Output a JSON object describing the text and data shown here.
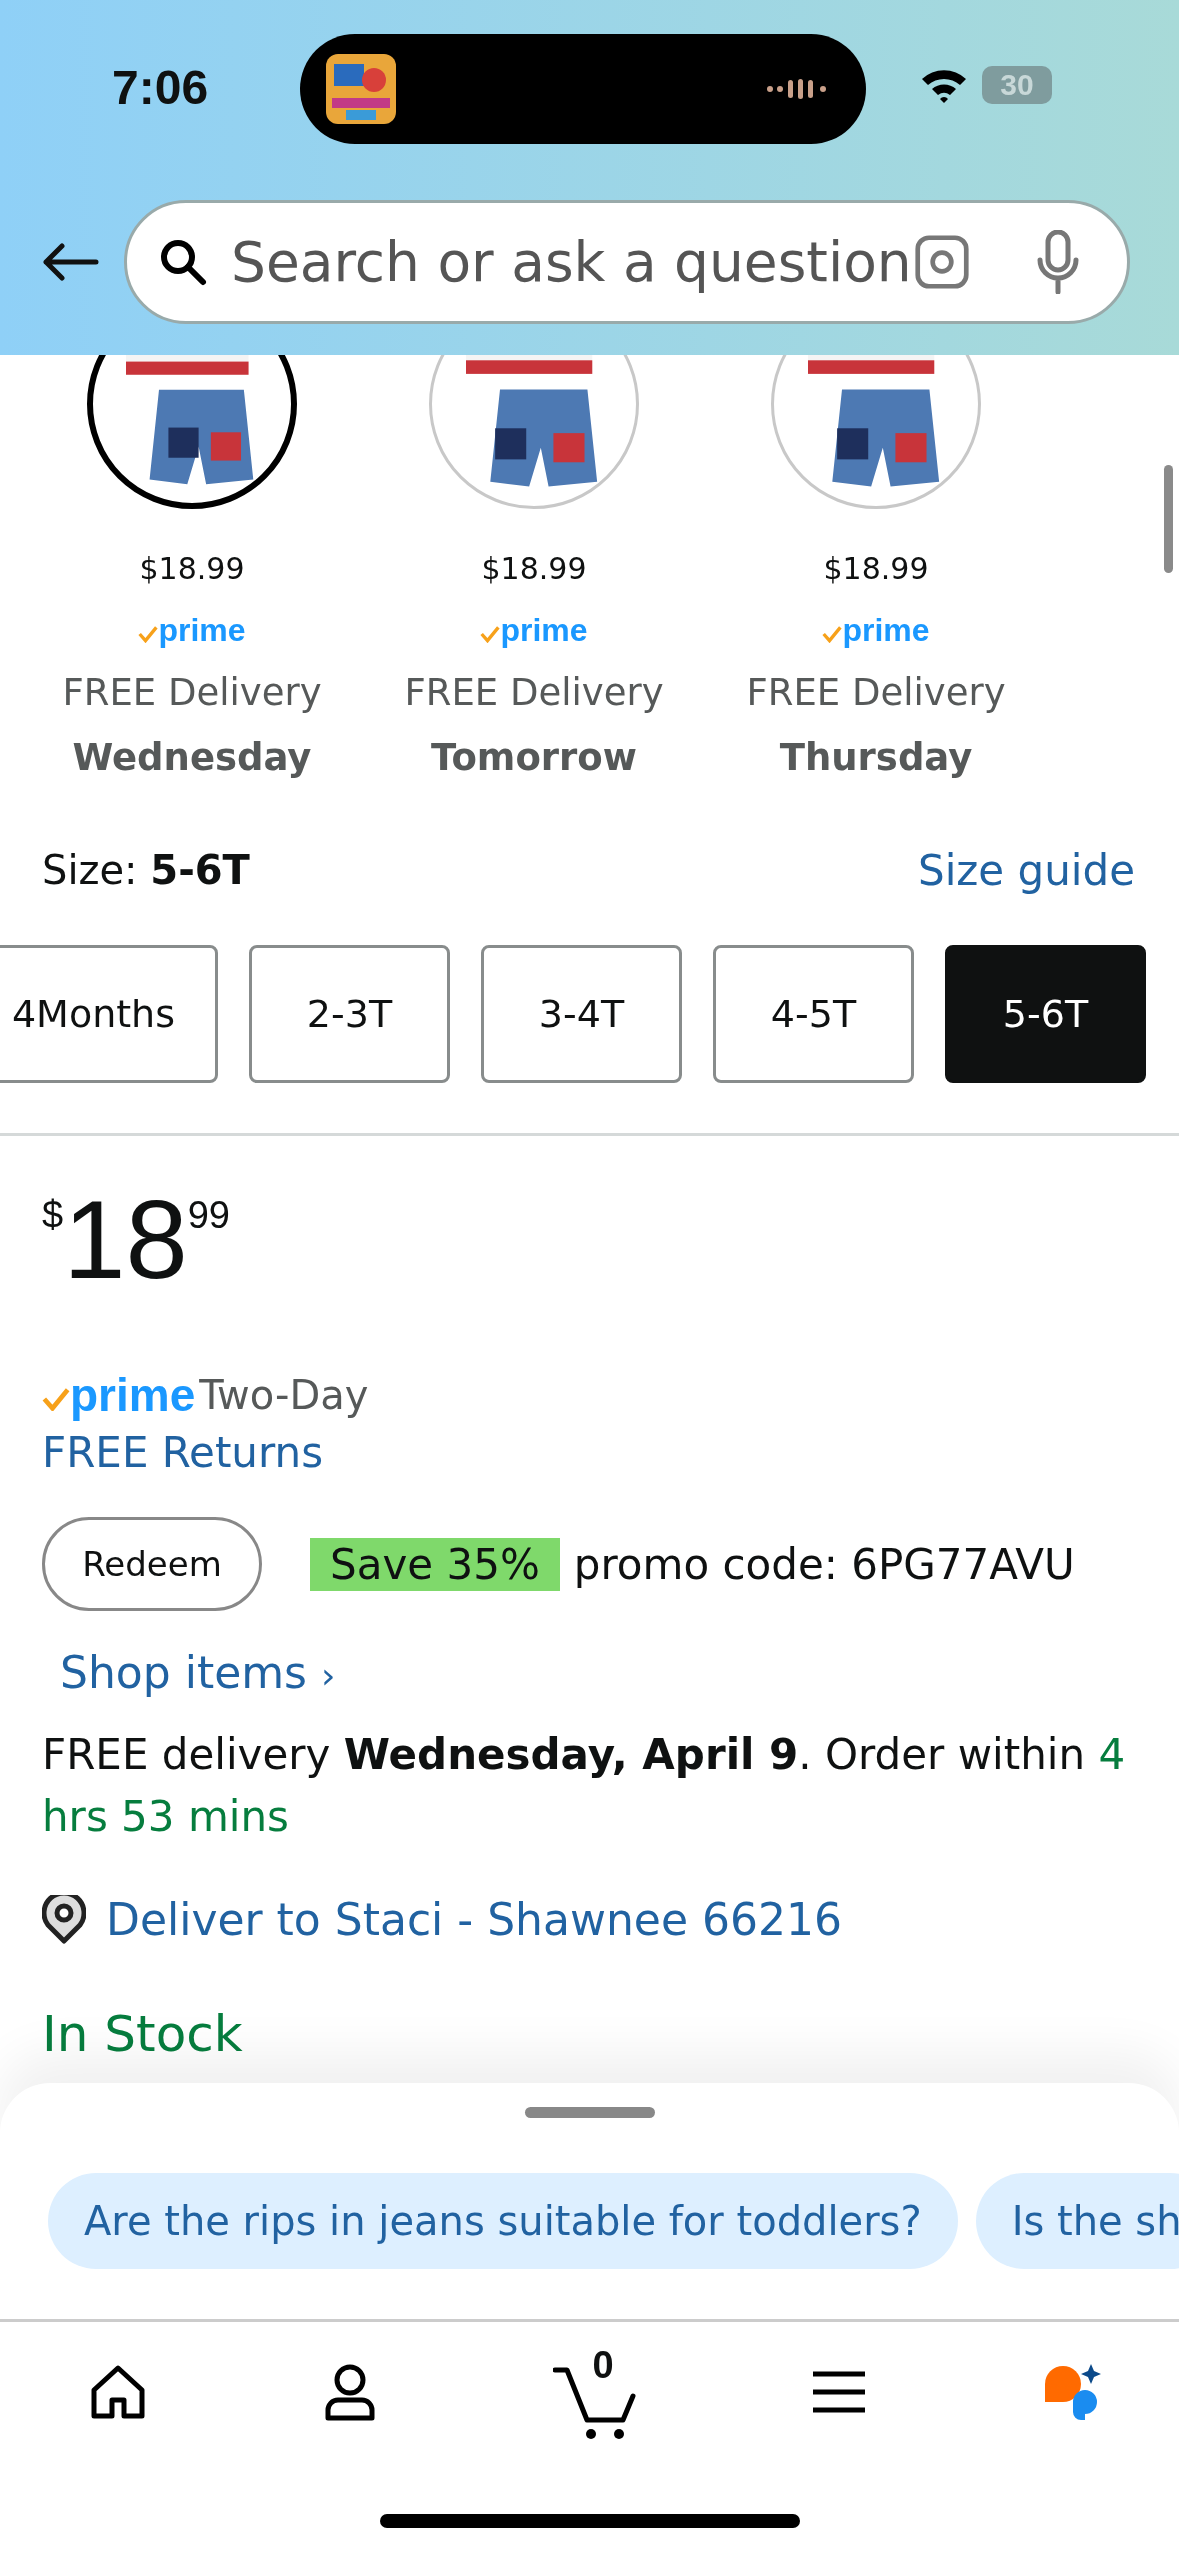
{
  "status_bar": {
    "time": "7:06",
    "battery": "30"
  },
  "search": {
    "placeholder": "Search or ask a question"
  },
  "variants": [
    {
      "price": "$18.99",
      "badge": "prime",
      "delivery": "FREE Delivery",
      "day": "Wednesday",
      "selected": true
    },
    {
      "price": "$18.99",
      "badge": "prime",
      "delivery": "FREE Delivery",
      "day": "Tomorrow",
      "selected": false
    },
    {
      "price": "$18.99",
      "badge": "prime",
      "delivery": "FREE Delivery",
      "day": "Thursday",
      "selected": false
    }
  ],
  "size": {
    "label": "Size:",
    "value": "5-6T",
    "guide": "Size guide",
    "options": [
      {
        "label": "4Months",
        "selected": false
      },
      {
        "label": "2-3T",
        "selected": false
      },
      {
        "label": "3-4T",
        "selected": false
      },
      {
        "label": "4-5T",
        "selected": false
      },
      {
        "label": "5-6T",
        "selected": true
      }
    ]
  },
  "price": {
    "currency": "$",
    "whole": "18",
    "fraction": "99"
  },
  "shipping": {
    "badge": "prime",
    "speed": "Two-Day"
  },
  "returns": "FREE Returns",
  "promo": {
    "button": "Redeem",
    "discount": "Save 35%",
    "code": "promo code: 6PG77AVU"
  },
  "shop_link": {
    "label": "Shop items",
    "chevron": "›"
  },
  "delivery": {
    "text": "FREE delivery **Wednesday, April 9**. Order within",
    "countdown": "4 hrs 53 mins"
  },
  "deliver_to": "Deliver to Staci - Shawnee 66216",
  "stock": "In Stock",
  "suggestions": [
    "Are the rips in jeans suitable for toddlers?",
    "Is the sh"
  ],
  "nav": {
    "cart_count": "0"
  }
}
